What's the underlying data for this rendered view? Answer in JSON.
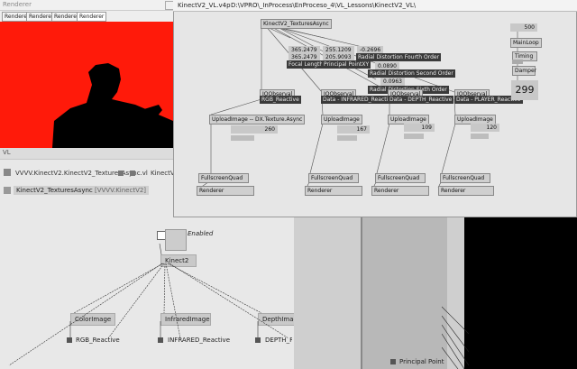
{
  "renderer": {
    "title": "Renderer",
    "tabs": [
      "Renderer",
      "Renderer",
      "Renderer",
      "Renderer"
    ],
    "canvas_color": "#ff1a0a"
  },
  "vl": {
    "title": "VL",
    "breadcrumb": "VVVV.KinectV2.KinectV2_TexturesAsync.vl",
    "breadcrumb_right": "KinectV2.",
    "doc_label": "KinectV2_TexturesAsync",
    "doc_type": "[VVVV.KinectV2]",
    "enabled_label": "Enabled",
    "kinect_node": "Kinect2",
    "image_nodes": [
      "ColorImage",
      "InfraredImage",
      "DepthImage"
    ],
    "outputs": [
      "RGB_Reactive",
      "INFRARED_Reactive",
      "DEPTH_Reactive"
    ],
    "principal_point": "Principal Point"
  },
  "patch": {
    "title": "KinectV2_VL.v4p",
    "path": "D:\\VPRO\\_InProcess\\EnProceso_4\\VL_Lessons\\KinectV2_VL\\",
    "main_node": "KinectV2_TexturesAsync",
    "focal_values": [
      "365.2479",
      "365.2479"
    ],
    "focal_label": "Focal LengthXY",
    "principal_values": [
      "255.1209",
      "205.9093"
    ],
    "principal_label": "Principal PointXY",
    "dist4_value": "-0.2696",
    "dist4_label": "Radial Distortion Fourth Order",
    "dist2_value": "0.0890",
    "dist2_label": "Radial Distortion Second Order",
    "dist6_value": "0.0963",
    "dist6_label": "Radial Distortion Sixth Order",
    "observe_label": "IOObserval",
    "data_labels": [
      "RGB_Reactive",
      "Data - INFRARED_Reactive",
      "Data - DEPTH_Reactive",
      "Data - PLAYER_Reactive"
    ],
    "upload_labels": [
      "UploadImage -- DX.Texture.Async",
      "UploadImage",
      "UploadImage",
      "UploadImage"
    ],
    "upload_values": [
      "260",
      "167",
      "109",
      "120"
    ],
    "quad_label": "FullscreenQuad",
    "renderer_label": "Renderer",
    "side_value": "500",
    "mainloop": "MainLoop",
    "timing": "Timing",
    "damper": "Damper",
    "big_value": "299"
  }
}
